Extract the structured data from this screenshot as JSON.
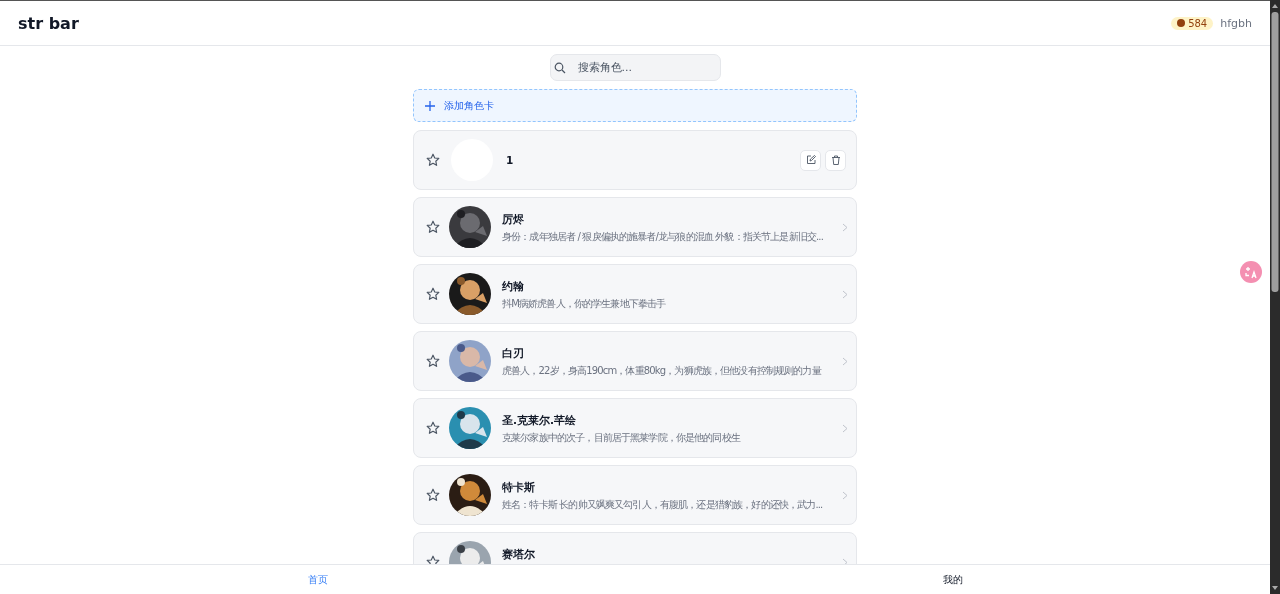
{
  "header": {
    "title": "str bar",
    "coins": "584",
    "username": "hfgbh"
  },
  "search": {
    "placeholder": "搜索角色..."
  },
  "add_button": {
    "label": "添加角色卡"
  },
  "cards": [
    {
      "kind": "own",
      "name": "1",
      "favorite": false,
      "avatar": {
        "kind": "blank"
      }
    },
    {
      "kind": "preset",
      "name": "厉烬",
      "description": "身份：成年独居者 / 狠戾偏执的施暴者/龙与狼的混血 外貌：指关节上是新旧交...",
      "favorite": false
    },
    {
      "kind": "preset",
      "name": "约翰",
      "description": "抖M病娇虎兽人，你的学生兼地下拳击手",
      "favorite": false
    },
    {
      "kind": "preset",
      "name": "白刃",
      "description": "虎兽人，22岁，身高190cm，体重80kg，为狮虎族，但他没有控制规则的力量",
      "favorite": false
    },
    {
      "kind": "preset",
      "name": "圣.克莱尔.芊绘",
      "description": "克莱尔家族中的次子，目前居于黑莱学院，你是他的同校生",
      "favorite": false
    },
    {
      "kind": "preset",
      "name": "特卡斯",
      "description": "姓名：特卡斯 长的帅又飒爽又勾引人，有腹肌，还是猎豹族，好的还快，武力...",
      "favorite": false
    },
    {
      "kind": "preset",
      "name": "赛塔尔",
      "favorite": false
    }
  ],
  "bottom_nav": [
    {
      "label": "首页",
      "selected": true
    },
    {
      "label": "我的",
      "selected": false
    }
  ]
}
